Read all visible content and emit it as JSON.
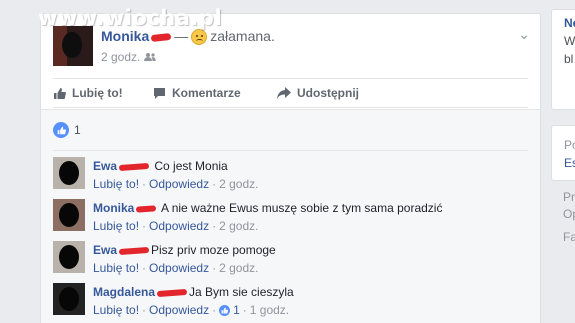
{
  "watermark": "www.wiocha.pl",
  "post": {
    "author": "Monika",
    "feeling_sep": "—",
    "feeling_icon": "sad-face-icon",
    "feeling": "załamana.",
    "time": "2 godz.",
    "audience_icon": "friends-icon",
    "menu_icon": "chevron-down-icon"
  },
  "actions": {
    "like": "Lubię to!",
    "comment": "Komentarze",
    "share": "Udostępnij"
  },
  "likes": {
    "count": "1"
  },
  "comments": [
    {
      "name": "Ewa",
      "text": "Co jest Monia",
      "like": "Lubię to!",
      "reply": "Odpowiedz",
      "time": "2 godz."
    },
    {
      "name": "Monika",
      "text": "A nie ważne Ewus muszę sobie z tym sama poradzić",
      "like": "Lubię to!",
      "reply": "Odpowiedz",
      "time": "2 godz."
    },
    {
      "name": "Ewa",
      "text": "Pisz priv moze pomoge",
      "like": "Lubię to!",
      "reply": "Odpowiedz",
      "time": "2 godz."
    },
    {
      "name": "Magdalena",
      "text": "Ja Bym sie cieszyla",
      "like": "Lubię to!",
      "reply": "Odpowiedz",
      "like_count": "1",
      "time": "1 godz."
    }
  ],
  "right_col": {
    "box1_line1": "Ne",
    "box1_line2": "W",
    "box1_line3": "bl",
    "box2_line1": "Po",
    "box2_line2": "Es",
    "footer1": "Pr",
    "footer2": "Op",
    "footer3": "Fa"
  },
  "colors": {
    "link": "#365899",
    "background": "#e9ebee",
    "like_blue": "#5890ff",
    "redaction": "#e2262c"
  }
}
